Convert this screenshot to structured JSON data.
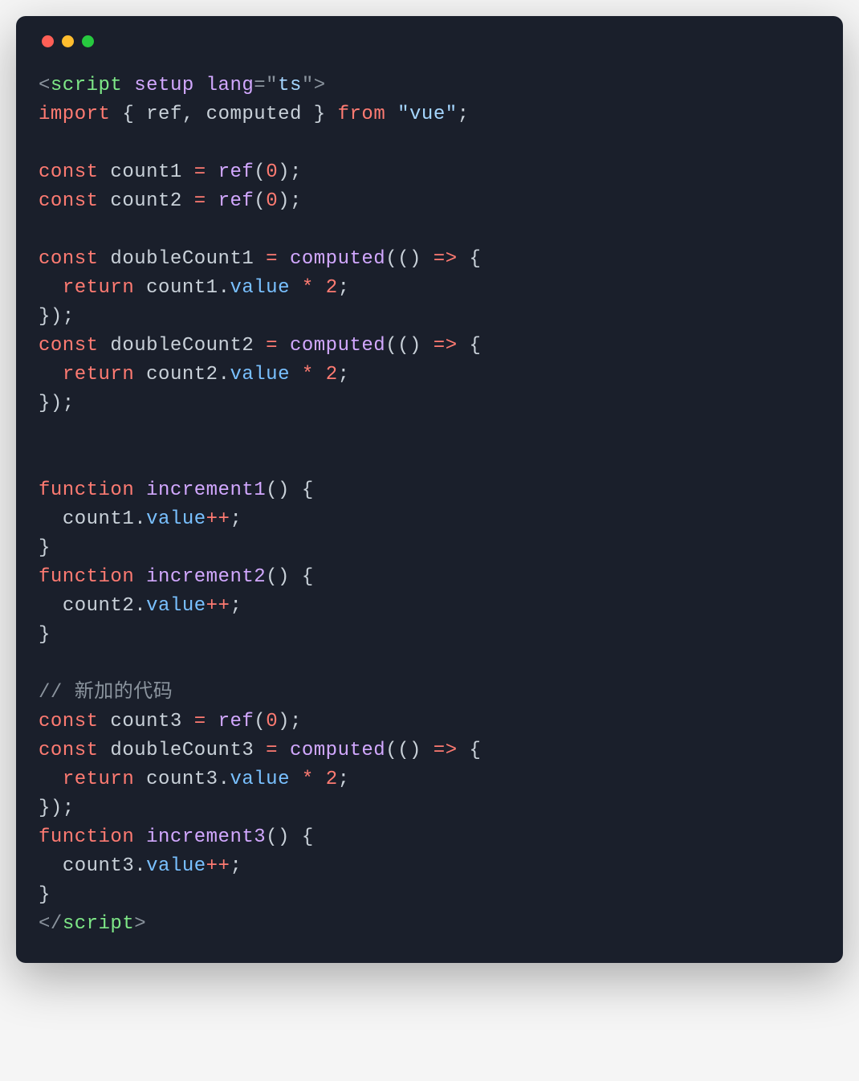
{
  "window": {
    "traffic_lights": [
      "red",
      "yellow",
      "green"
    ]
  },
  "code": {
    "lines": [
      [
        {
          "cls": "c-punct",
          "t": "<"
        },
        {
          "cls": "c-tag",
          "t": "script"
        },
        {
          "cls": "c-default",
          "t": " "
        },
        {
          "cls": "c-attr",
          "t": "setup"
        },
        {
          "cls": "c-default",
          "t": " "
        },
        {
          "cls": "c-attr",
          "t": "lang"
        },
        {
          "cls": "c-punct",
          "t": "="
        },
        {
          "cls": "c-punct",
          "t": "\""
        },
        {
          "cls": "c-str",
          "t": "ts"
        },
        {
          "cls": "c-punct",
          "t": "\""
        },
        {
          "cls": "c-punct",
          "t": ">"
        }
      ],
      [
        {
          "cls": "c-kw",
          "t": "import"
        },
        {
          "cls": "c-default",
          "t": " { "
        },
        {
          "cls": "c-ident",
          "t": "ref"
        },
        {
          "cls": "c-default",
          "t": ", "
        },
        {
          "cls": "c-ident",
          "t": "computed"
        },
        {
          "cls": "c-default",
          "t": " } "
        },
        {
          "cls": "c-kw",
          "t": "from"
        },
        {
          "cls": "c-default",
          "t": " "
        },
        {
          "cls": "c-str",
          "t": "\"vue\""
        },
        {
          "cls": "c-default",
          "t": ";"
        }
      ],
      [],
      [
        {
          "cls": "c-kw",
          "t": "const"
        },
        {
          "cls": "c-default",
          "t": " "
        },
        {
          "cls": "c-ident",
          "t": "count1"
        },
        {
          "cls": "c-default",
          "t": " "
        },
        {
          "cls": "c-op",
          "t": "="
        },
        {
          "cls": "c-default",
          "t": " "
        },
        {
          "cls": "c-func",
          "t": "ref"
        },
        {
          "cls": "c-default",
          "t": "("
        },
        {
          "cls": "c-num",
          "t": "0"
        },
        {
          "cls": "c-default",
          "t": ");"
        }
      ],
      [
        {
          "cls": "c-kw",
          "t": "const"
        },
        {
          "cls": "c-default",
          "t": " "
        },
        {
          "cls": "c-ident",
          "t": "count2"
        },
        {
          "cls": "c-default",
          "t": " "
        },
        {
          "cls": "c-op",
          "t": "="
        },
        {
          "cls": "c-default",
          "t": " "
        },
        {
          "cls": "c-func",
          "t": "ref"
        },
        {
          "cls": "c-default",
          "t": "("
        },
        {
          "cls": "c-num",
          "t": "0"
        },
        {
          "cls": "c-default",
          "t": ");"
        }
      ],
      [],
      [
        {
          "cls": "c-kw",
          "t": "const"
        },
        {
          "cls": "c-default",
          "t": " "
        },
        {
          "cls": "c-ident",
          "t": "doubleCount1"
        },
        {
          "cls": "c-default",
          "t": " "
        },
        {
          "cls": "c-op",
          "t": "="
        },
        {
          "cls": "c-default",
          "t": " "
        },
        {
          "cls": "c-func",
          "t": "computed"
        },
        {
          "cls": "c-default",
          "t": "(() "
        },
        {
          "cls": "c-kw",
          "t": "=>"
        },
        {
          "cls": "c-default",
          "t": " {"
        }
      ],
      [
        {
          "cls": "c-default",
          "t": "  "
        },
        {
          "cls": "c-kw",
          "t": "return"
        },
        {
          "cls": "c-default",
          "t": " "
        },
        {
          "cls": "c-ident",
          "t": "count1"
        },
        {
          "cls": "c-default",
          "t": "."
        },
        {
          "cls": "c-prop",
          "t": "value"
        },
        {
          "cls": "c-default",
          "t": " "
        },
        {
          "cls": "c-op",
          "t": "*"
        },
        {
          "cls": "c-default",
          "t": " "
        },
        {
          "cls": "c-num",
          "t": "2"
        },
        {
          "cls": "c-default",
          "t": ";"
        }
      ],
      [
        {
          "cls": "c-default",
          "t": "});"
        }
      ],
      [
        {
          "cls": "c-kw",
          "t": "const"
        },
        {
          "cls": "c-default",
          "t": " "
        },
        {
          "cls": "c-ident",
          "t": "doubleCount2"
        },
        {
          "cls": "c-default",
          "t": " "
        },
        {
          "cls": "c-op",
          "t": "="
        },
        {
          "cls": "c-default",
          "t": " "
        },
        {
          "cls": "c-func",
          "t": "computed"
        },
        {
          "cls": "c-default",
          "t": "(() "
        },
        {
          "cls": "c-kw",
          "t": "=>"
        },
        {
          "cls": "c-default",
          "t": " {"
        }
      ],
      [
        {
          "cls": "c-default",
          "t": "  "
        },
        {
          "cls": "c-kw",
          "t": "return"
        },
        {
          "cls": "c-default",
          "t": " "
        },
        {
          "cls": "c-ident",
          "t": "count2"
        },
        {
          "cls": "c-default",
          "t": "."
        },
        {
          "cls": "c-prop",
          "t": "value"
        },
        {
          "cls": "c-default",
          "t": " "
        },
        {
          "cls": "c-op",
          "t": "*"
        },
        {
          "cls": "c-default",
          "t": " "
        },
        {
          "cls": "c-num",
          "t": "2"
        },
        {
          "cls": "c-default",
          "t": ";"
        }
      ],
      [
        {
          "cls": "c-default",
          "t": "});"
        }
      ],
      [],
      [],
      [
        {
          "cls": "c-kw",
          "t": "function"
        },
        {
          "cls": "c-default",
          "t": " "
        },
        {
          "cls": "c-func",
          "t": "increment1"
        },
        {
          "cls": "c-default",
          "t": "() {"
        }
      ],
      [
        {
          "cls": "c-default",
          "t": "  "
        },
        {
          "cls": "c-ident",
          "t": "count1"
        },
        {
          "cls": "c-default",
          "t": "."
        },
        {
          "cls": "c-prop",
          "t": "value"
        },
        {
          "cls": "c-op",
          "t": "++"
        },
        {
          "cls": "c-default",
          "t": ";"
        }
      ],
      [
        {
          "cls": "c-default",
          "t": "}"
        }
      ],
      [
        {
          "cls": "c-kw",
          "t": "function"
        },
        {
          "cls": "c-default",
          "t": " "
        },
        {
          "cls": "c-func",
          "t": "increment2"
        },
        {
          "cls": "c-default",
          "t": "() {"
        }
      ],
      [
        {
          "cls": "c-default",
          "t": "  "
        },
        {
          "cls": "c-ident",
          "t": "count2"
        },
        {
          "cls": "c-default",
          "t": "."
        },
        {
          "cls": "c-prop",
          "t": "value"
        },
        {
          "cls": "c-op",
          "t": "++"
        },
        {
          "cls": "c-default",
          "t": ";"
        }
      ],
      [
        {
          "cls": "c-default",
          "t": "}"
        }
      ],
      [],
      [
        {
          "cls": "c-comment",
          "t": "// 新加的代码"
        }
      ],
      [
        {
          "cls": "c-kw",
          "t": "const"
        },
        {
          "cls": "c-default",
          "t": " "
        },
        {
          "cls": "c-ident",
          "t": "count3"
        },
        {
          "cls": "c-default",
          "t": " "
        },
        {
          "cls": "c-op",
          "t": "="
        },
        {
          "cls": "c-default",
          "t": " "
        },
        {
          "cls": "c-func",
          "t": "ref"
        },
        {
          "cls": "c-default",
          "t": "("
        },
        {
          "cls": "c-num",
          "t": "0"
        },
        {
          "cls": "c-default",
          "t": ");"
        }
      ],
      [
        {
          "cls": "c-kw",
          "t": "const"
        },
        {
          "cls": "c-default",
          "t": " "
        },
        {
          "cls": "c-ident",
          "t": "doubleCount3"
        },
        {
          "cls": "c-default",
          "t": " "
        },
        {
          "cls": "c-op",
          "t": "="
        },
        {
          "cls": "c-default",
          "t": " "
        },
        {
          "cls": "c-func",
          "t": "computed"
        },
        {
          "cls": "c-default",
          "t": "(() "
        },
        {
          "cls": "c-kw",
          "t": "=>"
        },
        {
          "cls": "c-default",
          "t": " {"
        }
      ],
      [
        {
          "cls": "c-default",
          "t": "  "
        },
        {
          "cls": "c-kw",
          "t": "return"
        },
        {
          "cls": "c-default",
          "t": " "
        },
        {
          "cls": "c-ident",
          "t": "count3"
        },
        {
          "cls": "c-default",
          "t": "."
        },
        {
          "cls": "c-prop",
          "t": "value"
        },
        {
          "cls": "c-default",
          "t": " "
        },
        {
          "cls": "c-op",
          "t": "*"
        },
        {
          "cls": "c-default",
          "t": " "
        },
        {
          "cls": "c-num",
          "t": "2"
        },
        {
          "cls": "c-default",
          "t": ";"
        }
      ],
      [
        {
          "cls": "c-default",
          "t": "});"
        }
      ],
      [
        {
          "cls": "c-kw",
          "t": "function"
        },
        {
          "cls": "c-default",
          "t": " "
        },
        {
          "cls": "c-func",
          "t": "increment3"
        },
        {
          "cls": "c-default",
          "t": "() {"
        }
      ],
      [
        {
          "cls": "c-default",
          "t": "  "
        },
        {
          "cls": "c-ident",
          "t": "count3"
        },
        {
          "cls": "c-default",
          "t": "."
        },
        {
          "cls": "c-prop",
          "t": "value"
        },
        {
          "cls": "c-op",
          "t": "++"
        },
        {
          "cls": "c-default",
          "t": ";"
        }
      ],
      [
        {
          "cls": "c-default",
          "t": "}"
        }
      ],
      [
        {
          "cls": "c-punct",
          "t": "</"
        },
        {
          "cls": "c-tag",
          "t": "script"
        },
        {
          "cls": "c-punct",
          "t": ">"
        }
      ]
    ]
  }
}
